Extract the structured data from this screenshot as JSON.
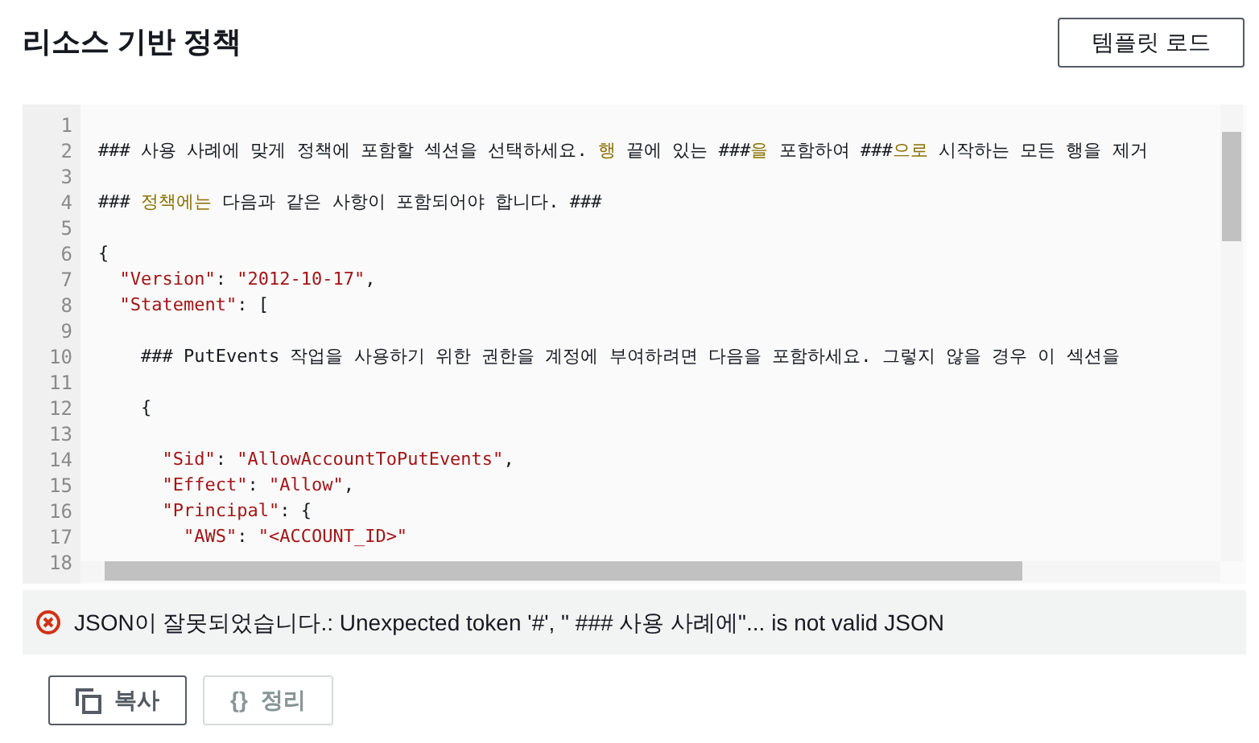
{
  "header": {
    "title": "리소스 기반 정책",
    "button": "템플릿 로드"
  },
  "editor": {
    "lines": [
      {
        "number": "1"
      },
      {
        "number": "2",
        "tokens": [
          {
            "kind": "plain",
            "text": "### 사용 사례에 맞게 정책에 포함할 섹션을 선택하세요. "
          },
          {
            "kind": "highlight",
            "text": "행"
          },
          {
            "kind": "plain",
            "text": " 끝에 있는 ###"
          },
          {
            "kind": "highlight",
            "text": "을"
          },
          {
            "kind": "plain",
            "text": " 포함하여 ###"
          },
          {
            "kind": "highlight",
            "text": "으로"
          },
          {
            "kind": "plain",
            "text": " 시작하는 모든 행을 제거"
          }
        ]
      },
      {
        "number": "3"
      },
      {
        "number": "4",
        "tokens": [
          {
            "kind": "plain",
            "text": "### "
          },
          {
            "kind": "highlight",
            "text": "정책에는"
          },
          {
            "kind": "plain",
            "text": " 다음과 같은 사항이 포함되어야 합니다. ###"
          }
        ]
      },
      {
        "number": "5"
      },
      {
        "number": "6",
        "tokens": [
          {
            "kind": "plain",
            "text": "{"
          }
        ]
      },
      {
        "number": "7",
        "tokens": [
          {
            "kind": "string",
            "text": "  \"Version\""
          },
          {
            "kind": "plain",
            "text": ": "
          },
          {
            "kind": "string",
            "text": "\"2012-10-17\""
          },
          {
            "kind": "plain",
            "text": ","
          }
        ]
      },
      {
        "number": "8",
        "tokens": [
          {
            "kind": "string",
            "text": "  \"Statement\""
          },
          {
            "kind": "plain",
            "text": ": ["
          }
        ]
      },
      {
        "number": "9"
      },
      {
        "number": "10",
        "tokens": [
          {
            "kind": "plain",
            "text": "    ### PutEvents 작업을 사용하기 위한 권한을 계정에 부여하려면 다음을 포함하세요. 그렇지 않을 경우 이 섹션을"
          }
        ]
      },
      {
        "number": "11"
      },
      {
        "number": "12",
        "tokens": [
          {
            "kind": "plain",
            "text": "    {"
          }
        ]
      },
      {
        "number": "13"
      },
      {
        "number": "14",
        "tokens": [
          {
            "kind": "string",
            "text": "      \"Sid\""
          },
          {
            "kind": "plain",
            "text": ": "
          },
          {
            "kind": "string",
            "text": "\"AllowAccountToPutEvents\""
          },
          {
            "kind": "plain",
            "text": ","
          }
        ]
      },
      {
        "number": "15",
        "tokens": [
          {
            "kind": "string",
            "text": "      \"Effect\""
          },
          {
            "kind": "plain",
            "text": ": "
          },
          {
            "kind": "string",
            "text": "\"Allow\""
          },
          {
            "kind": "plain",
            "text": ","
          }
        ]
      },
      {
        "number": "16",
        "tokens": [
          {
            "kind": "string",
            "text": "      \"Principal\""
          },
          {
            "kind": "plain",
            "text": ": {"
          }
        ]
      },
      {
        "number": "17",
        "tokens": [
          {
            "kind": "string",
            "text": "        \"AWS\""
          },
          {
            "kind": "plain",
            "text": ": "
          },
          {
            "kind": "string",
            "text": "\"<ACCOUNT_ID>\""
          }
        ]
      },
      {
        "number": "18"
      }
    ]
  },
  "error": {
    "message": "JSON이 잘못되었습니다.: Unexpected token '#', \" ### 사용 사례에\"... is not valid JSON"
  },
  "buttons": [
    {
      "kind": "copy",
      "label": "복사",
      "disabled": false
    },
    {
      "kind": "format",
      "icon_text": "{}",
      "label": "정리",
      "disabled": true
    }
  ]
}
